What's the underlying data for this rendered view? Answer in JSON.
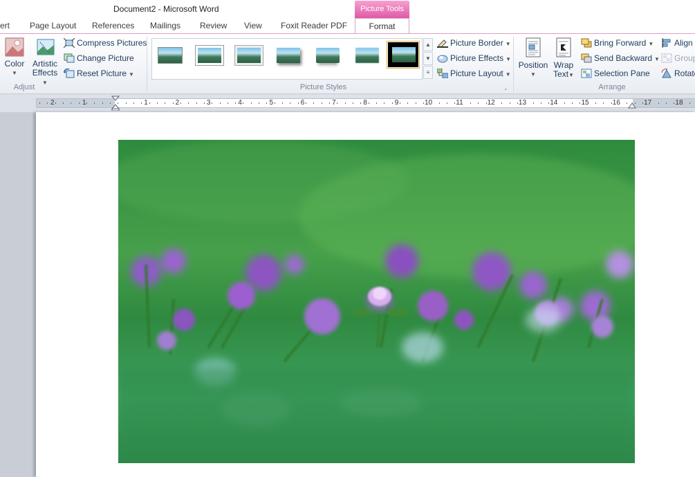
{
  "window": {
    "title": "Document2  -  Microsoft Word",
    "context_tab_header": "Picture Tools"
  },
  "tabs": [
    {
      "label": "ert",
      "active": false
    },
    {
      "label": "Page Layout",
      "active": false
    },
    {
      "label": "References",
      "active": false
    },
    {
      "label": "Mailings",
      "active": false
    },
    {
      "label": "Review",
      "active": false
    },
    {
      "label": "View",
      "active": false
    },
    {
      "label": "Foxit Reader PDF",
      "active": false
    },
    {
      "label": "Format",
      "active": true
    }
  ],
  "ribbon": {
    "adjust": {
      "label": "Adjust",
      "color": {
        "line1": "Color"
      },
      "artistic": {
        "line1": "Artistic",
        "line2": "Effects"
      },
      "compress": "Compress Pictures",
      "change": "Change Picture",
      "reset": "Reset Picture"
    },
    "styles": {
      "label": "Picture Styles",
      "selected_index": 6,
      "border": "Picture Border",
      "effects": "Picture Effects",
      "layout": "Picture Layout"
    },
    "arrange": {
      "label": "Arrange",
      "position": "Position",
      "wrap": {
        "line1": "Wrap",
        "line2": "Text"
      },
      "bring_forward": "Bring Forward",
      "send_backward": "Send Backward",
      "selection_pane": "Selection Pane",
      "align": "Align",
      "group": "Group",
      "rotate": "Rotate"
    }
  },
  "ruler": {
    "left_labels": [
      "2",
      "1"
    ],
    "labels": [
      "1",
      "2",
      "3",
      "4",
      "5",
      "6",
      "7",
      "8",
      "9",
      "10",
      "11",
      "12",
      "13",
      "14",
      "15",
      "16",
      "17",
      "18"
    ]
  },
  "colors": {
    "accent_context": "#e05aa6",
    "ribbon_text": "#1e395b",
    "photo_green": "#2e8b3e",
    "flower_purple": "#9a5fc7"
  }
}
